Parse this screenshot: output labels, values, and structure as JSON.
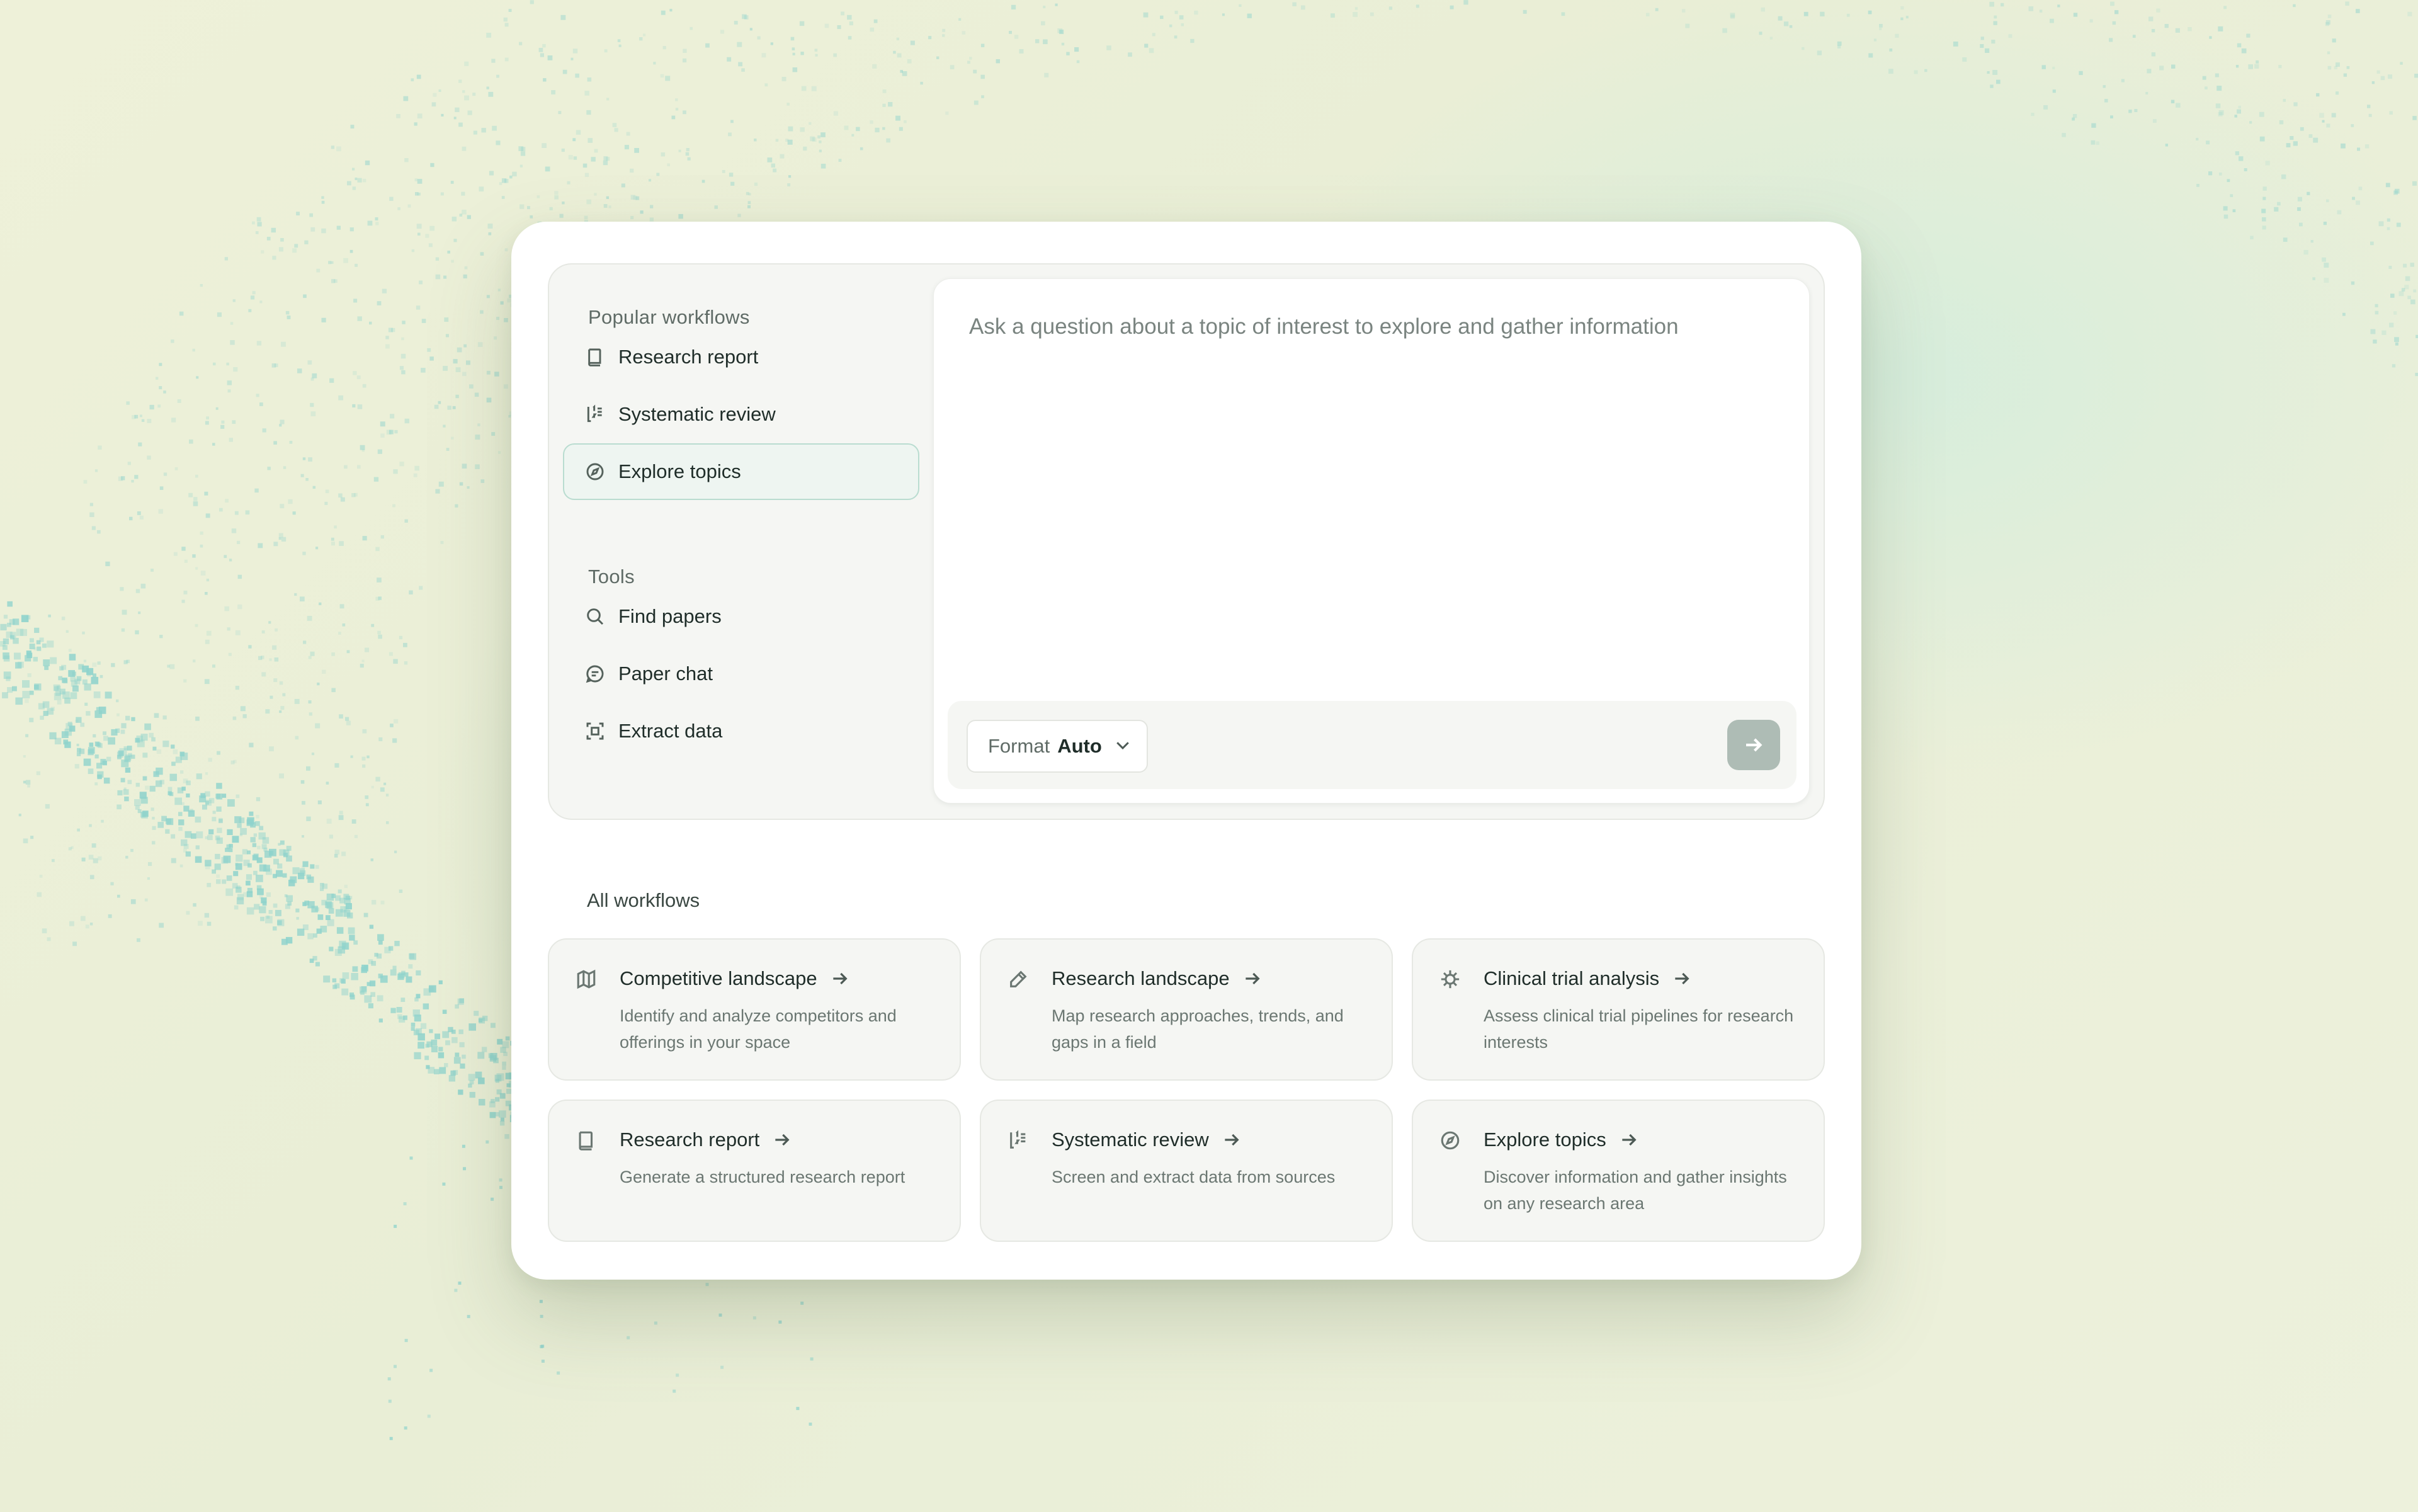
{
  "sidebar": {
    "popular_label": "Popular workflows",
    "popular_items": [
      {
        "label": "Research report",
        "icon": "book-icon"
      },
      {
        "label": "Systematic review",
        "icon": "numbered-list-icon"
      },
      {
        "label": "Explore topics",
        "icon": "compass-icon",
        "active": true
      }
    ],
    "tools_label": "Tools",
    "tool_items": [
      {
        "label": "Find papers",
        "icon": "search-icon"
      },
      {
        "label": "Paper chat",
        "icon": "chat-bubble-icon"
      },
      {
        "label": "Extract data",
        "icon": "scan-frame-icon"
      }
    ]
  },
  "composer": {
    "placeholder": "Ask a question about a topic of interest to explore and gather information",
    "format_label": "Format",
    "format_value": "Auto"
  },
  "all_workflows": {
    "label": "All workflows",
    "items": [
      {
        "title": "Competitive landscape",
        "desc": "Identify and analyze competitors and offerings in your space",
        "icon": "map-icon"
      },
      {
        "title": "Research landscape",
        "desc": "Map research approaches, trends, and gaps in a field",
        "icon": "pencil-icon"
      },
      {
        "title": "Clinical trial analysis",
        "desc": "Assess clinical trial pipelines for research interests",
        "icon": "virus-icon"
      },
      {
        "title": "Research report",
        "desc": "Generate a structured research report",
        "icon": "book-icon"
      },
      {
        "title": "Systematic review",
        "desc": "Screen and extract data from sources",
        "icon": "numbered-list-icon"
      },
      {
        "title": "Explore topics",
        "desc": "Discover information and gather insights on any research area",
        "icon": "compass-icon"
      }
    ]
  },
  "colors": {
    "accent_border": "#b9dcd0",
    "send_button": "#aebcb5",
    "text_primary": "#1f2d29",
    "text_secondary": "#6b7772"
  }
}
